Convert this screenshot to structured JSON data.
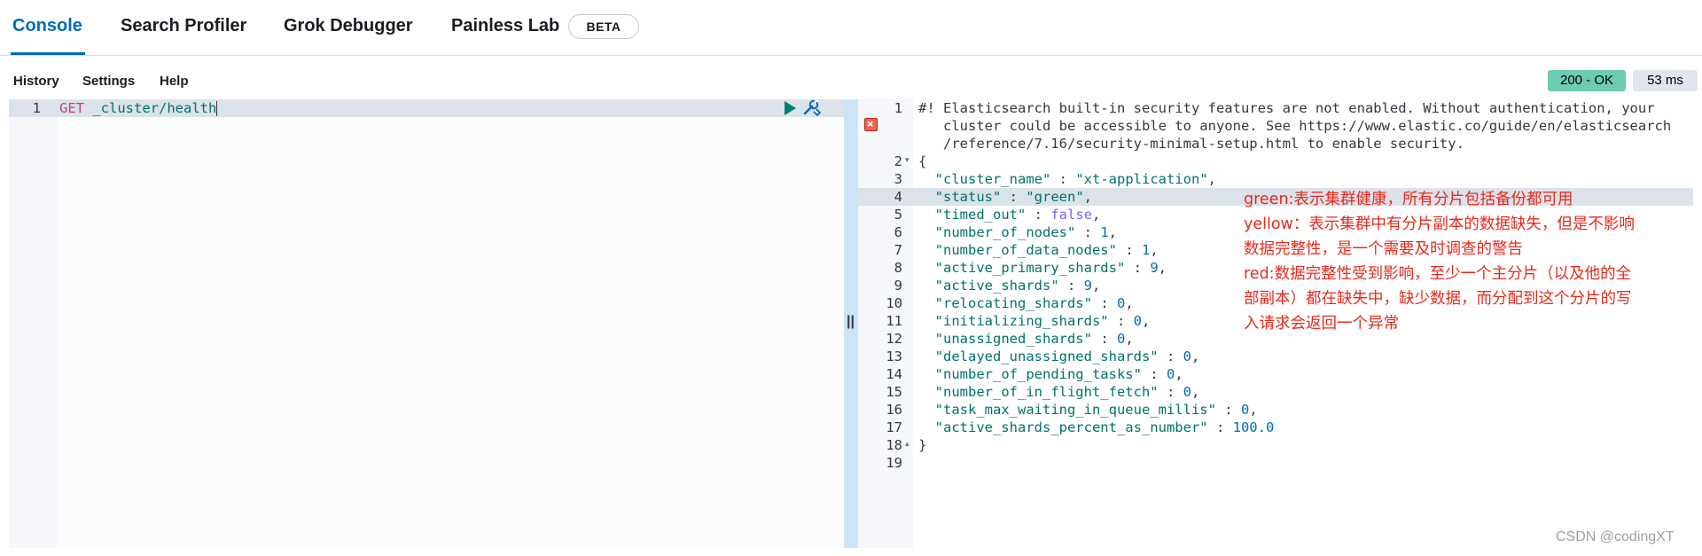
{
  "tabs": [
    {
      "label": "Console"
    },
    {
      "label": "Search Profiler"
    },
    {
      "label": "Grok Debugger"
    },
    {
      "label": "Painless Lab"
    }
  ],
  "beta_badge": "BETA",
  "menu": {
    "history": "History",
    "settings": "Settings",
    "help": "Help"
  },
  "status": {
    "code": "200 - OK",
    "time": "53 ms"
  },
  "request": {
    "line_number": "1",
    "method": "GET",
    "path": "_cluster/health"
  },
  "response": {
    "line_numbers": [
      "1",
      "2",
      "3",
      "4",
      "5",
      "6",
      "7",
      "8",
      "9",
      "10",
      "11",
      "12",
      "13",
      "14",
      "15",
      "16",
      "17",
      "18",
      "19"
    ],
    "warning_lines": [
      "#! Elasticsearch built-in security features are not enabled. Without authentication, your",
      "   cluster could be accessible to anyone. See https://www.elastic.co/guide/en/elasticsearch",
      "   /reference/7.16/security-minimal-setup.html to enable security."
    ],
    "open_brace": "{",
    "close_brace": "}",
    "fields": [
      {
        "key": "\"cluster_name\"",
        "value": "\"xt-application\"",
        "type": "str",
        "comma": ","
      },
      {
        "key": "\"status\"",
        "value": "\"green\"",
        "type": "str",
        "comma": ","
      },
      {
        "key": "\"timed_out\"",
        "value": "false",
        "type": "bool",
        "comma": ","
      },
      {
        "key": "\"number_of_nodes\"",
        "value": "1",
        "type": "num",
        "comma": ","
      },
      {
        "key": "\"number_of_data_nodes\"",
        "value": "1",
        "type": "num",
        "comma": ","
      },
      {
        "key": "\"active_primary_shards\"",
        "value": "9",
        "type": "num",
        "comma": ","
      },
      {
        "key": "\"active_shards\"",
        "value": "9",
        "type": "num",
        "comma": ","
      },
      {
        "key": "\"relocating_shards\"",
        "value": "0",
        "type": "num",
        "comma": ","
      },
      {
        "key": "\"initializing_shards\"",
        "value": "0",
        "type": "num",
        "comma": ","
      },
      {
        "key": "\"unassigned_shards\"",
        "value": "0",
        "type": "num",
        "comma": ","
      },
      {
        "key": "\"delayed_unassigned_shards\"",
        "value": "0",
        "type": "num",
        "comma": ","
      },
      {
        "key": "\"number_of_pending_tasks\"",
        "value": "0",
        "type": "num",
        "comma": ","
      },
      {
        "key": "\"number_of_in_flight_fetch\"",
        "value": "0",
        "type": "num",
        "comma": ","
      },
      {
        "key": "\"task_max_waiting_in_queue_millis\"",
        "value": "0",
        "type": "num",
        "comma": ","
      },
      {
        "key": "\"active_shards_percent_as_number\"",
        "value": "100.0",
        "type": "num",
        "comma": ""
      }
    ]
  },
  "annotation": [
    "green:表示集群健康，所有分片包括备份都可用",
    "yellow：表示集群中有分片副本的数据缺失，但是不影响",
    "数据完整性，是一个需要及时调查的警告",
    "red:数据完整性受到影响，至少一个主分片（以及他的全",
    "部副本）都在缺失中，缺少数据，而分配到这个分片的写",
    "入请求会返回一个异常"
  ],
  "watermark": "CSDN @codingXT",
  "colors": {
    "accent": "#006bb8",
    "ok_badge": "#6dccb1",
    "annotation_red": "#e8291c"
  }
}
